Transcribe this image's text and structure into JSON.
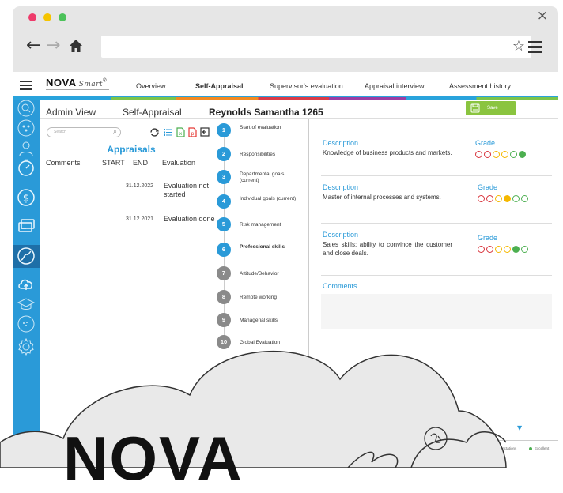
{
  "browser": {
    "close_glyph": "×",
    "back_glyph": "←",
    "forward_glyph": "→",
    "star_glyph": "☆"
  },
  "header": {
    "logo_text": "NOVA",
    "logo_script": "Smart",
    "logo_mark": "®",
    "tabs": [
      {
        "label": "Overview",
        "active": false
      },
      {
        "label": "Self-Appraisal",
        "active": true
      },
      {
        "label": "Supervisor's evaluation",
        "active": false
      },
      {
        "label": "Appraisal interview",
        "active": false
      },
      {
        "label": "Assessment history",
        "active": false
      }
    ]
  },
  "subheader": {
    "admin_view": "Admin View",
    "title": "Self-Appraisal",
    "employee": "Reynolds Samantha 1265",
    "save_label": "Save"
  },
  "appraisals": {
    "search_placeholder": "Search",
    "title": "Appraisals",
    "columns": [
      "Comments",
      "START",
      "END",
      "Evaluation"
    ],
    "rows": [
      {
        "end": "31.12.2022",
        "evaluation": "Evaluation not started"
      },
      {
        "end": "31.12.2021",
        "evaluation": "Evaluation done"
      }
    ]
  },
  "steps": [
    {
      "num": "1",
      "label": "Start of evaluation",
      "state": "done"
    },
    {
      "num": "2",
      "label": "Responsibilities",
      "state": "done"
    },
    {
      "num": "3",
      "label": "Departmental goals (current)",
      "state": "done"
    },
    {
      "num": "4",
      "label": "Individual goals (current)",
      "state": "done"
    },
    {
      "num": "5",
      "label": "Risk management",
      "state": "done"
    },
    {
      "num": "6",
      "label": "Professional skills",
      "state": "active"
    },
    {
      "num": "7",
      "label": "Attitude/Behavior",
      "state": "todo"
    },
    {
      "num": "8",
      "label": "Remote working",
      "state": "todo"
    },
    {
      "num": "9",
      "label": "Managerial skills",
      "state": "todo"
    },
    {
      "num": "10",
      "label": "Global Evaluation",
      "state": "todo"
    }
  ],
  "criteria": [
    {
      "desc_label": "Description",
      "text": "Knowledge of business products and markets.",
      "grade_label": "Grade",
      "selected": 6
    },
    {
      "desc_label": "Description",
      "text": "Master of internal processes and systems.",
      "grade_label": "Grade",
      "selected": 4
    },
    {
      "desc_label": "Description",
      "text": "Sales skills: ability to convince the customer and close deals.",
      "grade_label": "Grade",
      "selected": 5
    }
  ],
  "grade_colors": [
    "#d9363e",
    "#d9363e",
    "#f5b800",
    "#f5b800",
    "#4caf50",
    "#4caf50"
  ],
  "comments_label": "Comments",
  "scroll_glyph": "▼",
  "legend": [
    {
      "label": "expectations",
      "color": "#f5b800"
    },
    {
      "label": "Above expectations",
      "color": "#4caf50"
    },
    {
      "label": "Excellent",
      "color": "#4caf50"
    }
  ],
  "overlay": {
    "brand_text": "NOVA"
  },
  "colors": {
    "accent": "#2a9ad8",
    "save": "#8ac43f",
    "sidebar_active": "#1e6fa8"
  }
}
